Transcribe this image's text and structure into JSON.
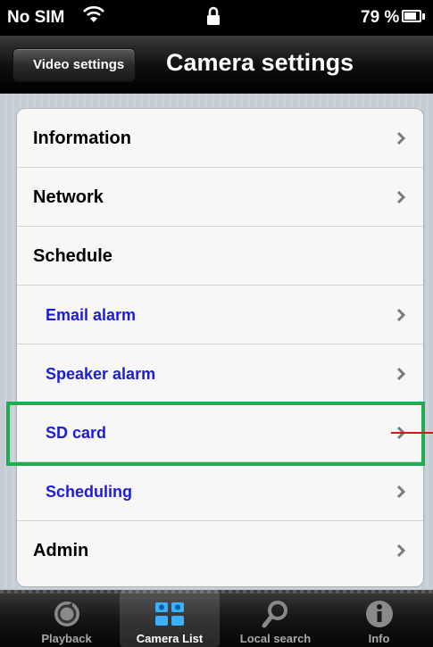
{
  "status_bar": {
    "carrier": "No SIM",
    "battery_percent": "79 %"
  },
  "nav": {
    "back_label": "Video settings",
    "title": "Camera settings"
  },
  "rows": [
    {
      "label": "Information",
      "style": "main",
      "chevron": true
    },
    {
      "label": "Network",
      "style": "main",
      "chevron": true
    },
    {
      "label": "Schedule",
      "style": "main",
      "chevron": false
    },
    {
      "label": "Email alarm",
      "style": "sub",
      "chevron": true
    },
    {
      "label": "Speaker alarm",
      "style": "sub",
      "chevron": true
    },
    {
      "label": "SD card",
      "style": "sub",
      "chevron": true,
      "highlighted": true
    },
    {
      "label": "Scheduling",
      "style": "sub",
      "chevron": true
    },
    {
      "label": "Admin",
      "style": "main",
      "chevron": true
    }
  ],
  "tabs": [
    {
      "label": "Playback",
      "icon": "playback-icon",
      "active": false
    },
    {
      "label": "Camera List",
      "icon": "camera-list-icon",
      "active": true
    },
    {
      "label": "Local search",
      "icon": "search-icon",
      "active": false
    },
    {
      "label": "Info",
      "icon": "info-icon",
      "active": false
    }
  ],
  "colors": {
    "sub_item_text": "#1c1cd8",
    "highlight_box": "#1ead52",
    "pointer_line": "#d41818",
    "active_tab_label": "#ffffff"
  }
}
